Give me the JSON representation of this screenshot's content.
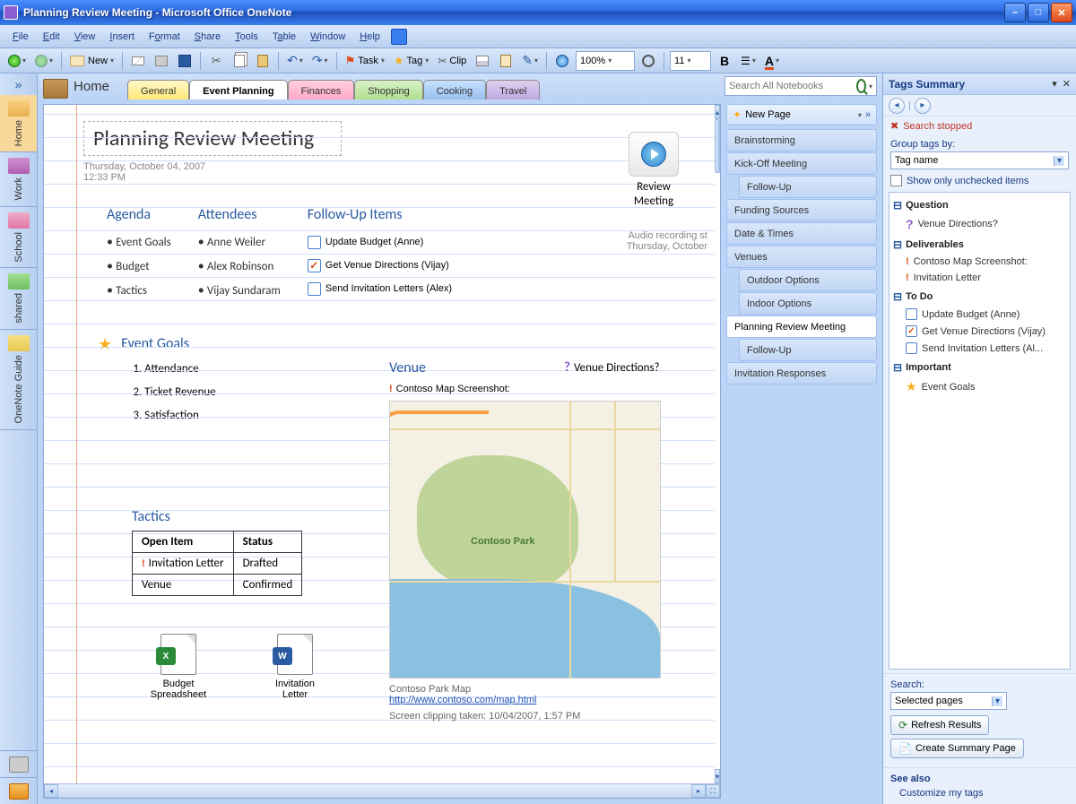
{
  "titlebar": {
    "title": "Planning Review Meeting - Microsoft Office OneNote"
  },
  "menu": {
    "file": "File",
    "edit": "Edit",
    "view": "View",
    "insert": "Insert",
    "format": "Format",
    "share": "Share",
    "tools": "Tools",
    "table": "Table",
    "window": "Window",
    "help": "Help"
  },
  "toolbar": {
    "new_label": "New",
    "task_label": "Task",
    "tag_label": "Tag",
    "clip_label": "Clip",
    "zoom": "100%",
    "font_size": "11"
  },
  "notebooks": {
    "home": "Home",
    "work": "Work",
    "school": "School",
    "shared": "shared",
    "guide": "OneNote Guide"
  },
  "sections": {
    "home_label": "Home",
    "tabs": [
      {
        "label": "General",
        "cls": "general"
      },
      {
        "label": "Event Planning",
        "cls": "event"
      },
      {
        "label": "Finances",
        "cls": "finances"
      },
      {
        "label": "Shopping",
        "cls": "shopping"
      },
      {
        "label": "Cooking",
        "cls": "cooking"
      },
      {
        "label": "Travel",
        "cls": "travel"
      }
    ],
    "search_placeholder": "Search All Notebooks"
  },
  "page": {
    "title": "Planning Review Meeting",
    "date": "Thursday, October 04, 2007",
    "time": "12:33 PM",
    "agenda_hdr": "Agenda",
    "agenda": [
      "Event Goals",
      "Budget",
      "Tactics"
    ],
    "attendees_hdr": "Attendees",
    "attendees": [
      "Anne Weiler",
      "Alex Robinson",
      "Vijay Sundaram"
    ],
    "followup_hdr": "Follow-Up Items",
    "followup": [
      {
        "label": "Update Budget (Anne)",
        "done": false
      },
      {
        "label": "Get Venue Directions (Vijay)",
        "done": true
      },
      {
        "label": "Send Invitation Letters (Alex)",
        "done": false
      }
    ],
    "rec_label": "Review Meeting",
    "audio_meta1": "Audio recording st",
    "audio_meta2": "Thursday, October",
    "goals_hdr": "Event Goals",
    "goals": [
      "Attendance",
      "Ticket Revenue",
      "Satisfaction"
    ],
    "venue_hdr": "Venue",
    "venue_q": "Venue Directions?",
    "map_label": "Contoso Map Screenshot:",
    "park_label": "Contoso Park",
    "map_caption": "Contoso Park Map",
    "map_link": "http://www.contoso.com/map.html",
    "map_clip": "Screen clipping taken: 10/04/2007, 1:57 PM",
    "tactics_hdr": "Tactics",
    "tactics_cols": [
      "Open Item",
      "Status"
    ],
    "tactics_rows": [
      {
        "item": "Invitation Letter",
        "status": "Drafted",
        "bang": true
      },
      {
        "item": "Venue",
        "status": "Confirmed",
        "bang": false
      }
    ],
    "files": [
      {
        "label": "Budget Spreadsheet",
        "type": "xls"
      },
      {
        "label": "Invitation Letter",
        "type": "docx"
      }
    ]
  },
  "pagetabs": {
    "new_label": "New Page",
    "items": [
      {
        "label": "Brainstorming",
        "sub": false
      },
      {
        "label": "Kick-Off Meeting",
        "sub": false
      },
      {
        "label": "Follow-Up",
        "sub": true
      },
      {
        "label": "Funding Sources",
        "sub": false
      },
      {
        "label": "Date & Times",
        "sub": false
      },
      {
        "label": "Venues",
        "sub": false
      },
      {
        "label": "Outdoor Options",
        "sub": true
      },
      {
        "label": "Indoor Options",
        "sub": true
      },
      {
        "label": "Planning Review Meeting",
        "sub": false,
        "sel": true
      },
      {
        "label": "Follow-Up",
        "sub": true
      },
      {
        "label": "Invitation Responses",
        "sub": false
      }
    ]
  },
  "tags": {
    "header": "Tags Summary",
    "search_stopped": "Search stopped",
    "group_label": "Group tags by:",
    "group_value": "Tag name",
    "show_unchecked": "Show only unchecked items",
    "groups": [
      {
        "name": "Question",
        "items": [
          {
            "icon": "q",
            "label": "Venue Directions?"
          }
        ]
      },
      {
        "name": "Deliverables",
        "items": [
          {
            "icon": "ex",
            "label": "Contoso Map Screenshot:"
          },
          {
            "icon": "ex",
            "label": "Invitation Letter"
          }
        ]
      },
      {
        "name": "To Do",
        "items": [
          {
            "icon": "chk",
            "label": "Update Budget (Anne)",
            "done": false
          },
          {
            "icon": "chk",
            "label": "Get Venue Directions (Vijay)",
            "done": true
          },
          {
            "icon": "chk",
            "label": "Send Invitation Letters (Al...",
            "done": false
          }
        ]
      },
      {
        "name": "Important",
        "items": [
          {
            "icon": "star",
            "label": "Event Goals"
          }
        ]
      }
    ],
    "search_label": "Search:",
    "search_scope": "Selected pages",
    "refresh": "Refresh Results",
    "summary": "Create Summary Page",
    "seealso_hdr": "See also",
    "seealso_link": "Customize my tags"
  }
}
